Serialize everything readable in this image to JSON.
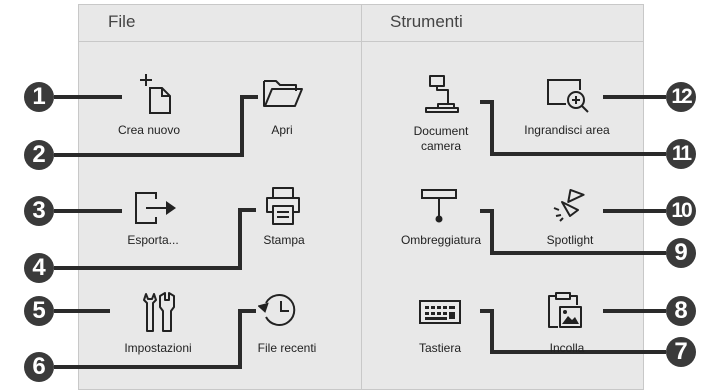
{
  "columns": {
    "file": "File",
    "tools": "Strumenti"
  },
  "items": {
    "crea_nuovo": "Crea nuovo",
    "apri": "Apri",
    "esporta": "Esporta...",
    "stampa": "Stampa",
    "impostazioni": "Impostazioni",
    "file_recenti": "File recenti",
    "document_camera": "Document camera",
    "ingrandisci_area": "Ingrandisci area",
    "ombreggiatura": "Ombreggiatura",
    "spotlight": "Spotlight",
    "tastiera": "Tastiera",
    "incolla": "Incolla"
  },
  "callouts": {
    "n1": "1",
    "n2": "2",
    "n3": "3",
    "n4": "4",
    "n5": "5",
    "n6": "6",
    "n7": "7",
    "n8": "8",
    "n9": "9",
    "n10": "10",
    "n11": "11",
    "n12": "12"
  },
  "colors": {
    "badge": "#3a3a3a",
    "panel": "#e8e8e8",
    "leader": "#2a2a2a"
  },
  "icons": [
    "new-file-icon",
    "folder-icon",
    "export-icon",
    "printer-icon",
    "settings-icon",
    "recent-files-icon",
    "document-camera-icon",
    "magnify-area-icon",
    "shade-icon",
    "spotlight-icon",
    "keyboard-icon",
    "paste-icon"
  ]
}
